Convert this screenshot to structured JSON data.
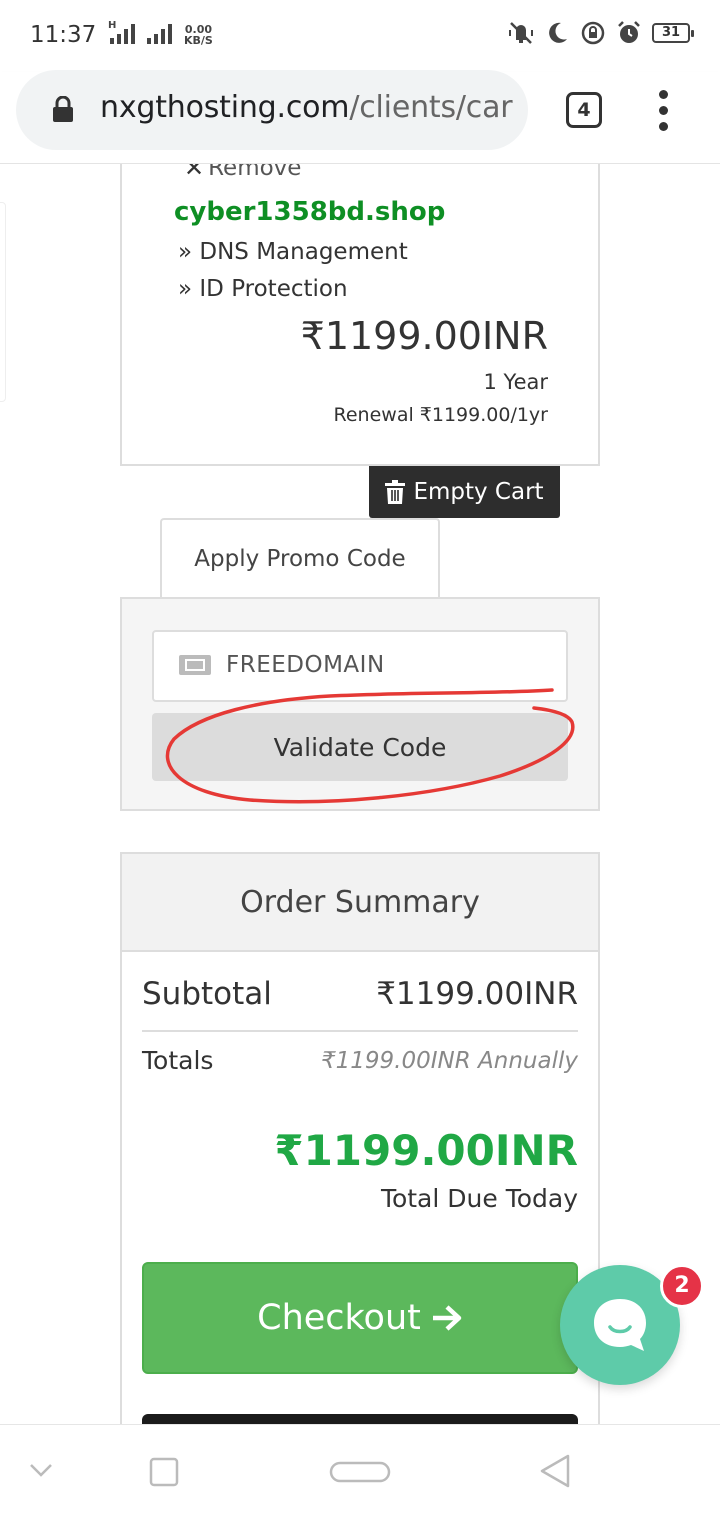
{
  "status_bar": {
    "time": "11:37",
    "network_h": "H",
    "speed_value": "0.00",
    "speed_unit": "KB/S",
    "battery": "31"
  },
  "browser": {
    "url_host": "nxgthosting.com",
    "url_path": "/clients/car",
    "tab_count": "4"
  },
  "cart_item": {
    "remove_label": "Remove",
    "domain": "cyber1358bd.shop",
    "addons": [
      "» DNS Management",
      "» ID Protection"
    ],
    "price": "₹1199.00INR",
    "term": "1 Year",
    "renewal": "Renewal ₹1199.00/1yr"
  },
  "empty_cart_label": "Empty Cart",
  "promo": {
    "tab_label": "Apply Promo Code",
    "code_value": "FREEDOMAIN",
    "validate_label": "Validate Code",
    "annotation_color": "#e53935"
  },
  "summary": {
    "title": "Order Summary",
    "subtotal_label": "Subtotal",
    "subtotal_value": "₹1199.00INR",
    "totals_label": "Totals",
    "totals_value": "₹1199.00INR Annually",
    "total_due": "₹1199.00INR",
    "total_due_label": "Total Due Today",
    "checkout_label": "Checkout"
  },
  "chat": {
    "badge_count": "2",
    "color": "#5ecba9"
  },
  "colors": {
    "accent_green": "#20a845",
    "checkout_green": "#5cb85c",
    "domain_green": "#0e8f24"
  }
}
